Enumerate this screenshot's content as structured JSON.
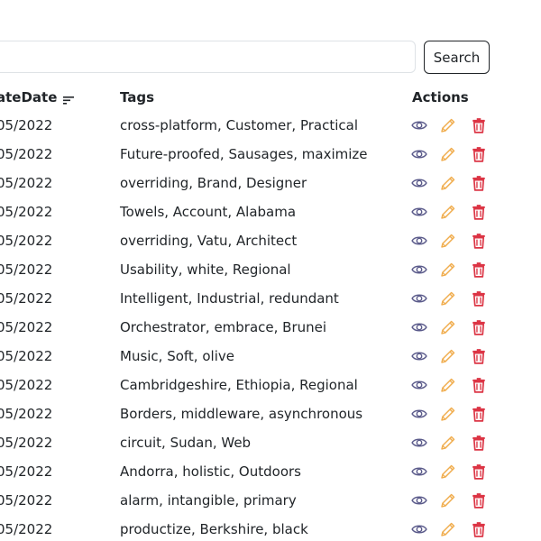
{
  "search": {
    "placeholder": "",
    "button_label": "Search"
  },
  "table": {
    "headers": {
      "date": "ateDate",
      "tags": "Tags",
      "actions": "Actions"
    },
    "rows": [
      {
        "date": "05/2022",
        "tags": "cross-platform, Customer, Practical"
      },
      {
        "date": "05/2022",
        "tags": "Future-proofed, Sausages, maximize"
      },
      {
        "date": "05/2022",
        "tags": "overriding, Brand, Designer"
      },
      {
        "date": "05/2022",
        "tags": "Towels, Account, Alabama"
      },
      {
        "date": "05/2022",
        "tags": "overriding, Vatu, Architect"
      },
      {
        "date": "05/2022",
        "tags": "Usability, white, Regional"
      },
      {
        "date": "05/2022",
        "tags": "Intelligent, Industrial, redundant"
      },
      {
        "date": "05/2022",
        "tags": "Orchestrator, embrace, Brunei"
      },
      {
        "date": "05/2022",
        "tags": "Music, Soft, olive"
      },
      {
        "date": "05/2022",
        "tags": "Cambridgeshire, Ethiopia, Regional"
      },
      {
        "date": "05/2022",
        "tags": "Borders, middleware, asynchronous"
      },
      {
        "date": "05/2022",
        "tags": "circuit, Sudan, Web"
      },
      {
        "date": "05/2022",
        "tags": "Andorra, holistic, Outdoors"
      },
      {
        "date": "05/2022",
        "tags": "alarm, intangible, primary"
      },
      {
        "date": "05/2022",
        "tags": "productize, Berkshire, black"
      }
    ]
  },
  "icons": {
    "sort": "sort-icon",
    "view": "eye-icon",
    "edit": "pencil-icon",
    "delete": "trash-icon"
  },
  "colors": {
    "view": "#5a5a8a",
    "edit": "#f0ad4e",
    "delete": "#dc3545",
    "border": "#dee2e6"
  }
}
